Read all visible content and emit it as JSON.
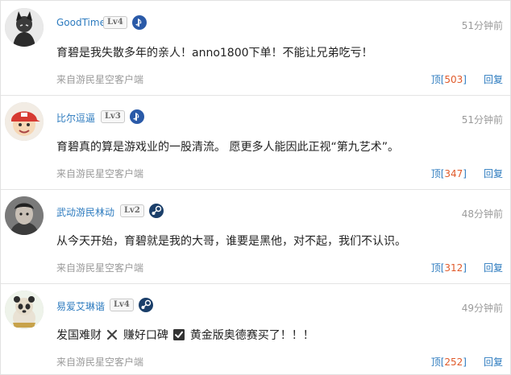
{
  "comments": [
    {
      "user": "GoodTime",
      "level": "Lv4",
      "platform": "playstation-icon",
      "time": "51分钟前",
      "content": "育碧是我失散多年的亲人！anno1800下单！不能让兄弟吃亏！",
      "source": "来自游民星空客户端",
      "like_label": "顶",
      "like_count": "503",
      "reply_label": "回复"
    },
    {
      "user": "比尔逗逼",
      "level": "Lv3",
      "platform": "playstation-icon",
      "time": "51分钟前",
      "content": "育碧真的算是游戏业的一股清流。 愿更多人能因此正视“第九艺术”。",
      "source": "来自游民星空客户端",
      "like_label": "顶",
      "like_count": "347",
      "reply_label": "回复"
    },
    {
      "user": "武动游民林动",
      "level": "Lv2",
      "platform": "steam-icon",
      "time": "48分钟前",
      "content": "从今天开始，育碧就是我的大哥，谁要是黑他，对不起，我们不认识。",
      "source": "来自游民星空客户端",
      "like_label": "顶",
      "like_count": "312",
      "reply_label": "回复"
    },
    {
      "user": "易爱艾琳谐",
      "level": "Lv4",
      "platform": "steam-icon",
      "time": "49分钟前",
      "content_parts": [
        "发国难财",
        "赚好口碑",
        "黄金版奥德赛买了！！！"
      ],
      "content_icons": [
        "cross-mark-icon",
        "check-mark-icon"
      ],
      "source": "来自游民星空客户端",
      "like_label": "顶",
      "like_count": "252",
      "reply_label": "回复"
    }
  ],
  "colors": {
    "username": "#2d7bbf",
    "meta": "#9a9a9a",
    "count": "#e05a2a",
    "divider": "#e4e4e4"
  }
}
